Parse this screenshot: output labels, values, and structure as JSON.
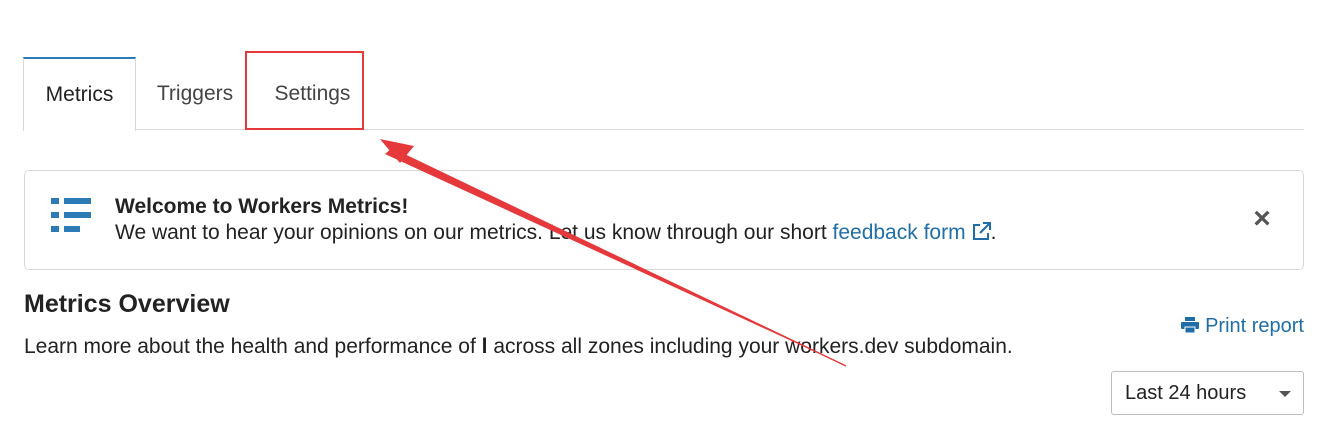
{
  "tabs": [
    {
      "label": "Metrics",
      "active": true
    },
    {
      "label": "Triggers",
      "active": false
    },
    {
      "label": "Settings",
      "active": false
    }
  ],
  "banner": {
    "icon": "list-icon",
    "title": "Welcome to Workers Metrics!",
    "text_before": "We want to hear your opinions on our metrics. Let us know through our short ",
    "link_text": "feedback form",
    "text_after": "."
  },
  "overview": {
    "title": "Metrics Overview",
    "desc_before": "Learn more about the health and performance of ",
    "desc_bold": "l",
    "desc_after": " across all zones including your workers.dev subdomain.",
    "print_label": "Print report",
    "time_range": "Last 24 hours"
  },
  "colors": {
    "accent": "#2d7bb6",
    "link": "#1f6ea8",
    "annotation": "#e5393b"
  }
}
